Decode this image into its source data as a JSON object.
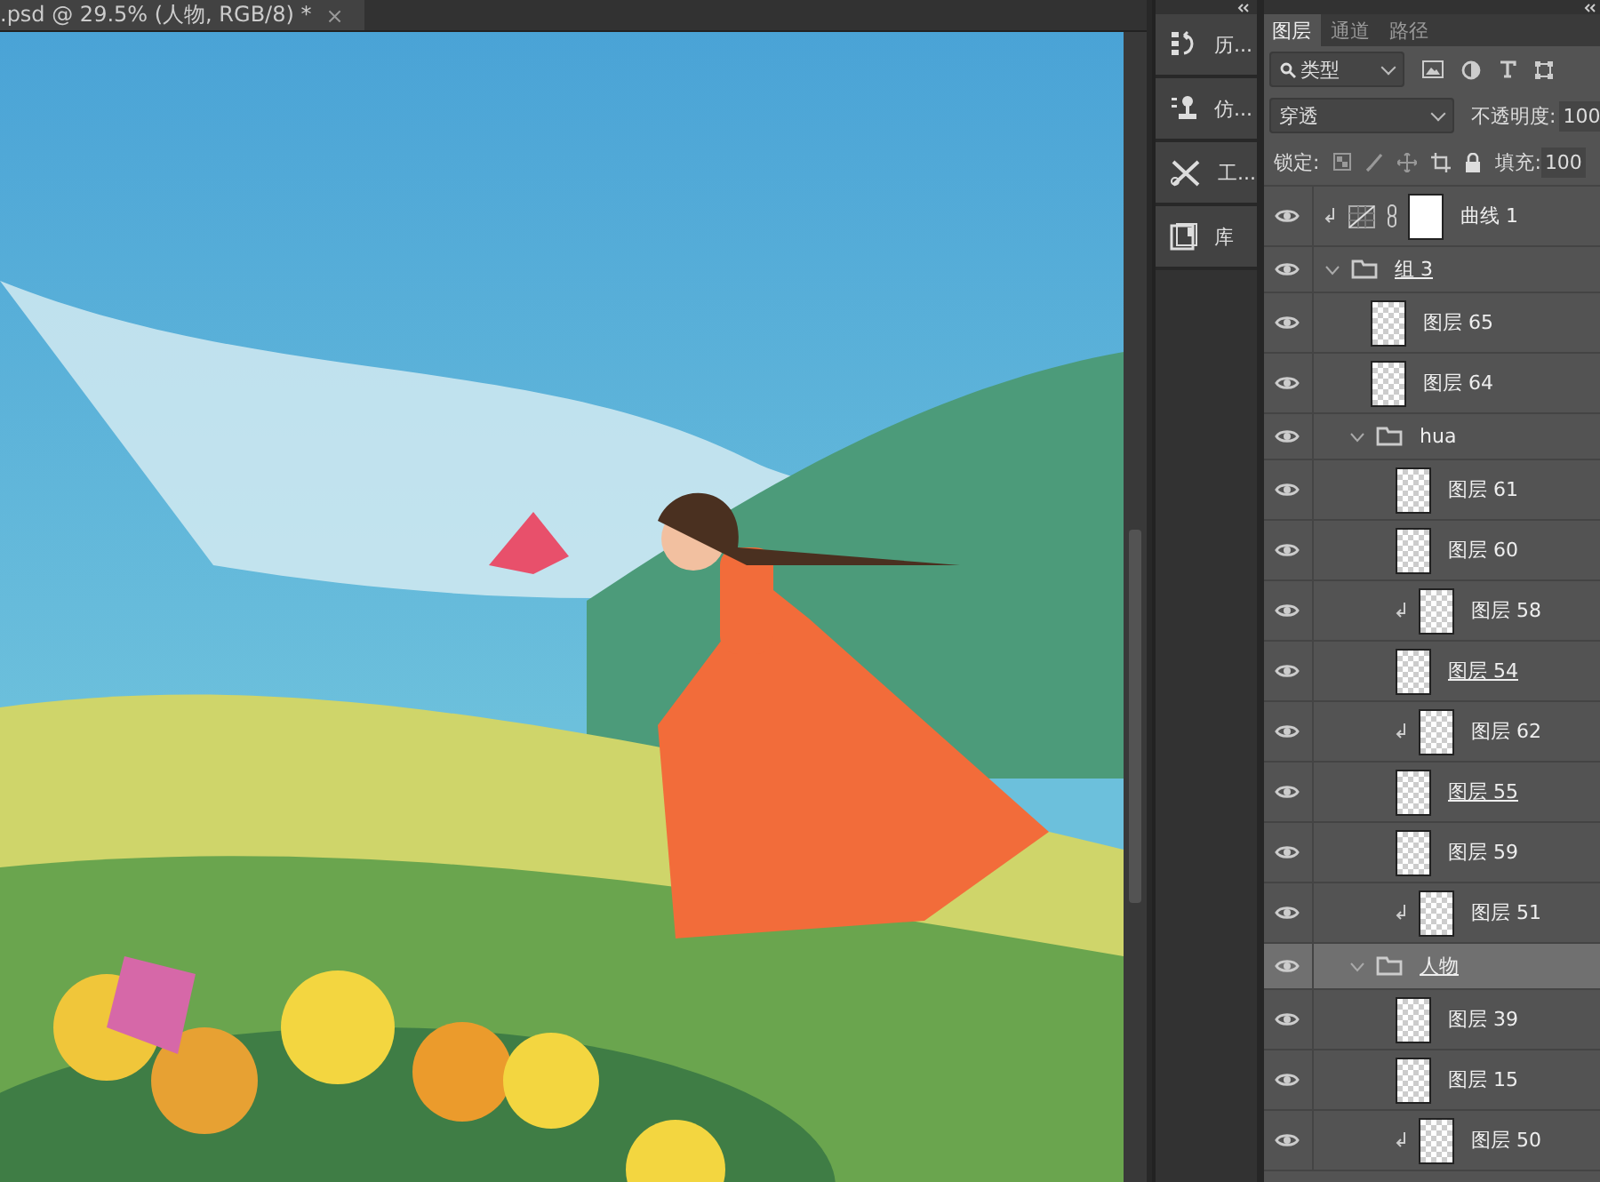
{
  "document_tab": {
    "title": ".psd @ 29.5% (人物, RGB/8) *",
    "close": "×"
  },
  "side_panels": [
    {
      "kind": "history",
      "label": "历..."
    },
    {
      "kind": "clone",
      "label": "仿..."
    },
    {
      "kind": "tools",
      "label": "工..."
    },
    {
      "kind": "library",
      "label": "库"
    }
  ],
  "layers_panel": {
    "tabs": [
      {
        "label": "图层",
        "selected": true
      },
      {
        "label": "通道",
        "selected": false
      },
      {
        "label": "路径",
        "selected": false
      }
    ],
    "filter": {
      "value": "类型"
    },
    "blend_mode": {
      "value": "穿透"
    },
    "opacity": {
      "label": "不透明度:",
      "value": "100"
    },
    "lock": {
      "label": "锁定:"
    },
    "fill": {
      "label": "填充:",
      "value": "100"
    },
    "layers": [
      {
        "kind": "adjustment",
        "name": "曲线 1",
        "visible": true,
        "clipped": true,
        "linked": false,
        "selected": false
      },
      {
        "kind": "group",
        "name": "组 3",
        "visible": true,
        "expanded": true,
        "linked": true,
        "selected": false,
        "children": [
          {
            "kind": "layer",
            "name": "图层 65",
            "visible": true,
            "clipped": false,
            "linked": false,
            "selected": false
          },
          {
            "kind": "layer",
            "name": "图层 64",
            "visible": true,
            "clipped": false,
            "linked": false,
            "selected": false
          },
          {
            "kind": "group",
            "name": "hua",
            "visible": true,
            "expanded": true,
            "linked": false,
            "selected": false,
            "children": [
              {
                "kind": "layer",
                "name": "图层 61",
                "visible": true,
                "clipped": false,
                "linked": false,
                "selected": false
              },
              {
                "kind": "layer",
                "name": "图层 60",
                "visible": true,
                "clipped": false,
                "linked": false,
                "selected": false
              },
              {
                "kind": "layer",
                "name": "图层 58",
                "visible": true,
                "clipped": true,
                "linked": false,
                "selected": false
              },
              {
                "kind": "layer",
                "name": "图层 54",
                "visible": true,
                "clipped": false,
                "linked": true,
                "selected": false
              },
              {
                "kind": "layer",
                "name": "图层 62",
                "visible": true,
                "clipped": true,
                "linked": false,
                "selected": false
              },
              {
                "kind": "layer",
                "name": "图层 55",
                "visible": true,
                "clipped": false,
                "linked": true,
                "selected": false
              },
              {
                "kind": "layer",
                "name": "图层 59",
                "visible": true,
                "clipped": false,
                "linked": false,
                "selected": false
              },
              {
                "kind": "layer",
                "name": "图层 51",
                "visible": true,
                "clipped": true,
                "linked": false,
                "selected": false
              }
            ]
          },
          {
            "kind": "group",
            "name": "人物",
            "visible": true,
            "expanded": true,
            "linked": true,
            "selected": true,
            "children": [
              {
                "kind": "layer",
                "name": "图层 39",
                "visible": true,
                "clipped": false,
                "linked": false,
                "selected": false
              },
              {
                "kind": "layer",
                "name": "图层 15",
                "visible": true,
                "clipped": false,
                "linked": false,
                "selected": false
              },
              {
                "kind": "layer",
                "name": "图层 50",
                "visible": true,
                "clipped": true,
                "linked": false,
                "selected": false
              }
            ]
          }
        ]
      }
    ]
  }
}
